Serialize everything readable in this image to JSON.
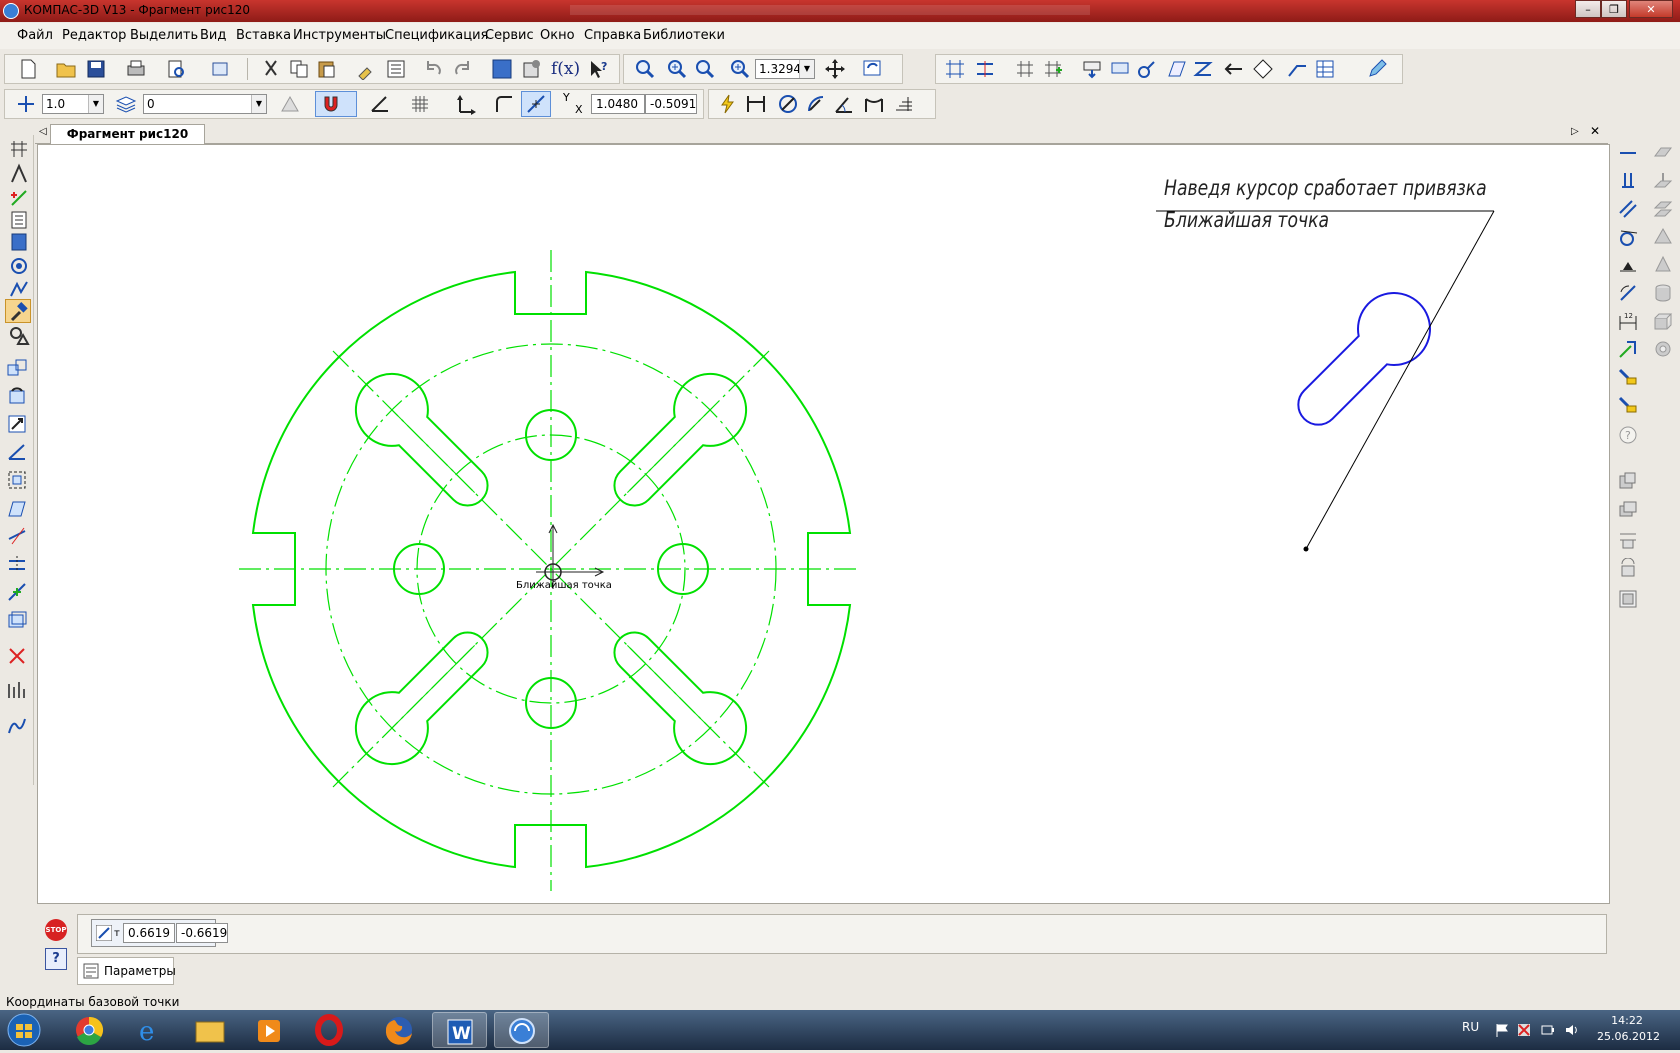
{
  "window": {
    "title": "КОМПАС-3D V13 - Фрагмент рис120"
  },
  "menu": [
    {
      "label": "Файл"
    },
    {
      "label": "Редактор"
    },
    {
      "label": "Выделить"
    },
    {
      "label": "Вид"
    },
    {
      "label": "Вставка"
    },
    {
      "label": "Инструменты"
    },
    {
      "label": "Спецификация"
    },
    {
      "label": "Сервис"
    },
    {
      "label": "Окно"
    },
    {
      "label": "Справка"
    },
    {
      "label": "Библиотеки"
    }
  ],
  "toolbar1": {
    "zoom_value": "1.3294",
    "fx_label": "f(x)"
  },
  "toolbar2": {
    "step_value": "1.0",
    "layer_value": "0",
    "coord_y_label": "Y",
    "coord_x_label": "X",
    "coord_x_value": "1.0480",
    "coord_y_value": "-0.5091"
  },
  "document": {
    "tab_label": "Фрагмент рис120"
  },
  "drawing": {
    "snap_tooltip": "Ближайшая точка",
    "annotation_line1": "Наведя курсор сработает привязка",
    "annotation_line2": "Ближайшая точка",
    "colors": {
      "geometry": "#00e000",
      "callout_shape": "#1a1ae0",
      "leader": "#000000"
    }
  },
  "properties": {
    "stop_label": "STOP",
    "help_label": "?",
    "point_label": "т",
    "base_x": "0.6619",
    "base_y": "-0.6619",
    "params_tab": "Параметры"
  },
  "status": {
    "text": "Координаты базовой точки"
  },
  "taskbar": {
    "lang": "RU",
    "time": "14:22",
    "date": "25.06.2012"
  }
}
